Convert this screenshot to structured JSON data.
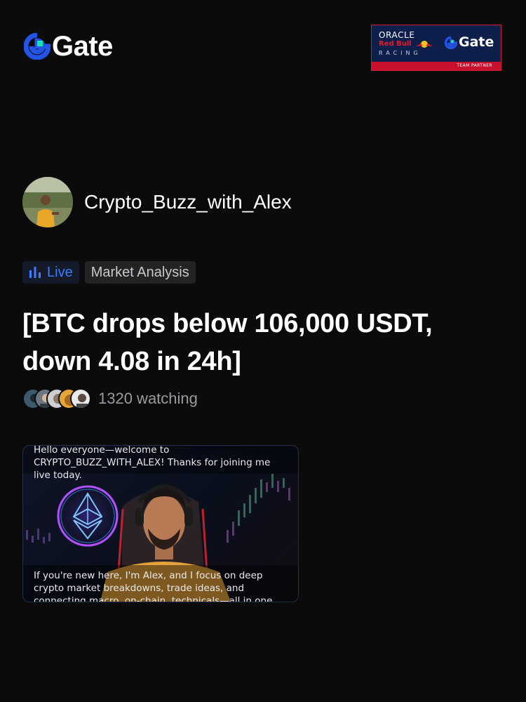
{
  "brand": {
    "name": "Gate",
    "accent": "#2354e6",
    "accent2": "#17e5b0"
  },
  "partner_badge": {
    "oracle": "ORACLE",
    "redbull": "Red Bull",
    "racing": "RACING",
    "gate": "Gate",
    "strip": "TEAM PARTNER"
  },
  "streamer": {
    "username": "Crypto_Buzz_with_Alex"
  },
  "tags": {
    "live": "Live",
    "topic": "Market Analysis",
    "live_color": "#3d7bff"
  },
  "stream": {
    "title": "[BTC drops below 106,000 USDT, down 4.08 in 24h]",
    "watching": "1320 watching"
  },
  "video": {
    "caption_top": "Hello everyone—welcome to CRYPTO_BUZZ_WITH_ALEX! Thanks for joining me live today.",
    "caption_bottom": "If you're new here, I'm Alex, and I focus on deep crypto market breakdowns, trade ideas, and connecting macro, on-chain, technicals—all in one stream."
  }
}
